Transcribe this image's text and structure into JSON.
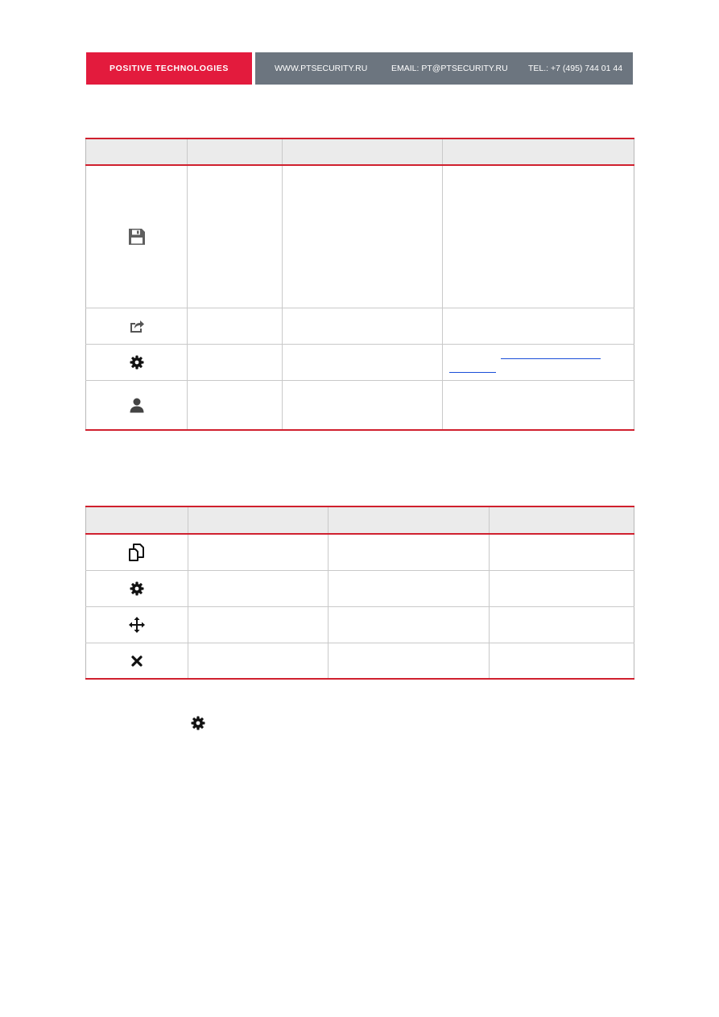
{
  "header": {
    "brand": "POSITIVE TECHNOLOGIES",
    "website": "WWW.PTSECURITY.RU",
    "email": "EMAIL: PT@PTSECURITY.RU",
    "phone": "TEL.: +7 (495) 744 01 44",
    "brand_color": "#e31b3d",
    "bar_color": "#6c757f"
  },
  "table1": {
    "headers": [
      "",
      "",
      "",
      ""
    ],
    "rows": [
      {
        "icon": "floppy-disk-save-icon",
        "cells": [
          "",
          "",
          ""
        ]
      },
      {
        "icon": "share-export-icon",
        "cells": [
          "",
          "",
          ""
        ]
      },
      {
        "icon": "gear-icon",
        "cells": [
          "",
          "",
          ""
        ]
      },
      {
        "icon": "user-icon",
        "cells": [
          "",
          "",
          ""
        ]
      }
    ]
  },
  "table2": {
    "headers": [
      "",
      "",
      "",
      ""
    ],
    "rows": [
      {
        "icon": "copy-icon",
        "cells": [
          "",
          "",
          ""
        ]
      },
      {
        "icon": "gear-icon",
        "cells": [
          "",
          "",
          ""
        ]
      },
      {
        "icon": "move-arrows-icon",
        "cells": [
          "",
          "",
          ""
        ]
      },
      {
        "icon": "close-x-icon",
        "cells": [
          "",
          "",
          ""
        ]
      }
    ]
  },
  "colors": {
    "table_rule": "#d0202e",
    "header_fill": "#ebebeb",
    "link": "#1a4fd8"
  }
}
